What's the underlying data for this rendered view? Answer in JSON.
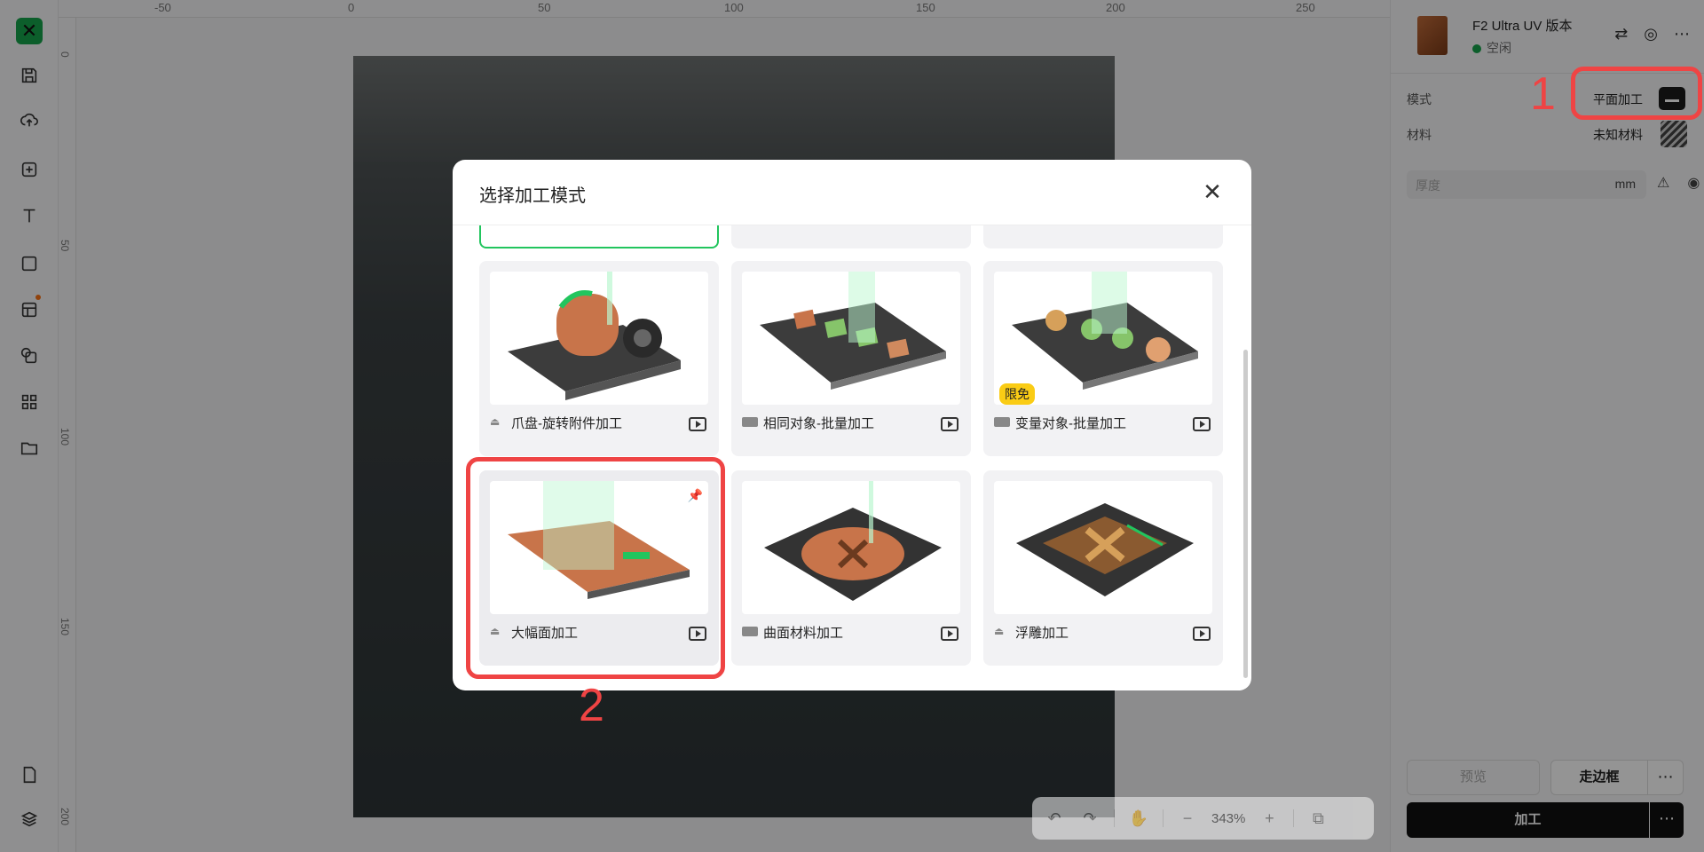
{
  "ruler": {
    "top_ticks": [
      "-50",
      "0",
      "50",
      "100",
      "150",
      "200",
      "250"
    ],
    "left_ticks": [
      "0",
      "50",
      "100",
      "150",
      "200"
    ]
  },
  "canvas_tools": {
    "zoom": "343%"
  },
  "device": {
    "name": "F2 Ultra UV 版本",
    "status": "空闲"
  },
  "panel": {
    "mode_label": "模式",
    "mode_value": "平面加工",
    "material_label": "材料",
    "material_value": "未知材料",
    "thickness_placeholder": "厚度",
    "thickness_unit": "mm"
  },
  "actions": {
    "preview": "预览",
    "frame": "走边框",
    "process": "加工"
  },
  "modal": {
    "title": "选择加工模式",
    "cards": [
      {
        "label": "爪盘-旋转附件加工"
      },
      {
        "label": "相同对象-批量加工"
      },
      {
        "label": "变量对象-批量加工",
        "badge": "限免"
      },
      {
        "label": "大幅面加工"
      },
      {
        "label": "曲面材料加工"
      },
      {
        "label": "浮雕加工"
      }
    ]
  },
  "annotations": {
    "one": "1",
    "two": "2"
  },
  "colors": {
    "accent": "#16a34a",
    "annotation": "#ef4444",
    "badge": "#facc15"
  }
}
